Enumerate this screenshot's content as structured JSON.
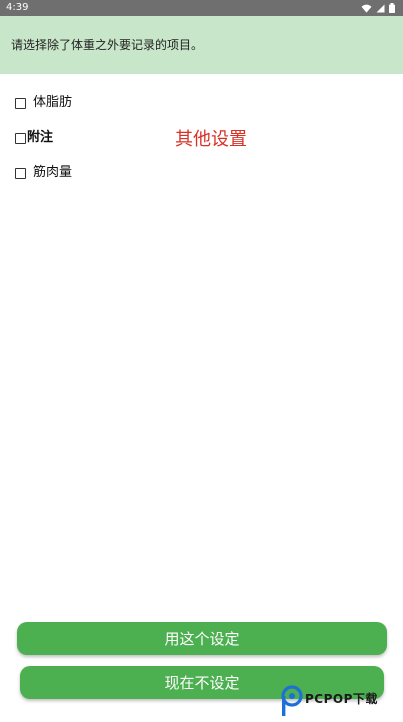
{
  "status_bar": {
    "time": "4:39",
    "icons": [
      "wifi-icon",
      "signal-icon",
      "battery-icon"
    ]
  },
  "header": {
    "instruction": "请选择除了体重之外要记录的项目。"
  },
  "options": [
    {
      "label": "体脂肪",
      "checked": false
    },
    {
      "label": "附注",
      "checked": false
    },
    {
      "label": "筋肉量",
      "checked": false
    }
  ],
  "other_settings_label": "其他设置",
  "buttons": {
    "use_setting": "用这个设定",
    "not_now": "现在不设定"
  },
  "watermark": {
    "text": "PCPOP下载"
  },
  "colors": {
    "header_bg": "#c8e6c9",
    "button_bg": "#4caf50",
    "accent_red": "#d93025",
    "status_bar_bg": "#6f6f6f"
  }
}
